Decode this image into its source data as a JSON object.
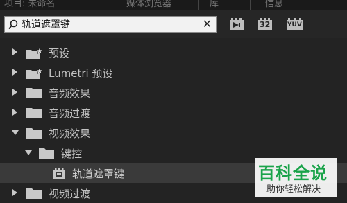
{
  "tabs": [
    "项目: 未命名",
    "媒体浏览器",
    "库",
    "信息"
  ],
  "search": {
    "value": "轨道遮罩键",
    "clear_glyph": "✕"
  },
  "toolbar_icons": [
    "accelerated-effects-icon",
    "32-bit-color-icon",
    "yuv-icon"
  ],
  "toolbar_labels": {
    "bit32": "32",
    "yuv": "YUV"
  },
  "tree": [
    {
      "label": "预设",
      "level": 0,
      "expanded": false,
      "kind": "preset-folder"
    },
    {
      "label": "Lumetri 预设",
      "level": 0,
      "expanded": false,
      "kind": "preset-folder"
    },
    {
      "label": "音频效果",
      "level": 0,
      "expanded": false,
      "kind": "folder"
    },
    {
      "label": "音频过渡",
      "level": 0,
      "expanded": false,
      "kind": "folder"
    },
    {
      "label": "视频效果",
      "level": 0,
      "expanded": true,
      "kind": "folder"
    },
    {
      "label": "键控",
      "level": 1,
      "expanded": true,
      "kind": "folder"
    },
    {
      "label": "轨道遮罩键",
      "level": 2,
      "selected": true,
      "kind": "effect"
    },
    {
      "label": "视频过渡",
      "level": 0,
      "expanded": false,
      "kind": "folder"
    }
  ],
  "watermark": {
    "title": "百科全说",
    "subtitle": "助你轻松解决"
  },
  "colors": {
    "panel": "#232323",
    "selected_row": "#3a3a3a",
    "watermark_green": "#1aa34a"
  }
}
